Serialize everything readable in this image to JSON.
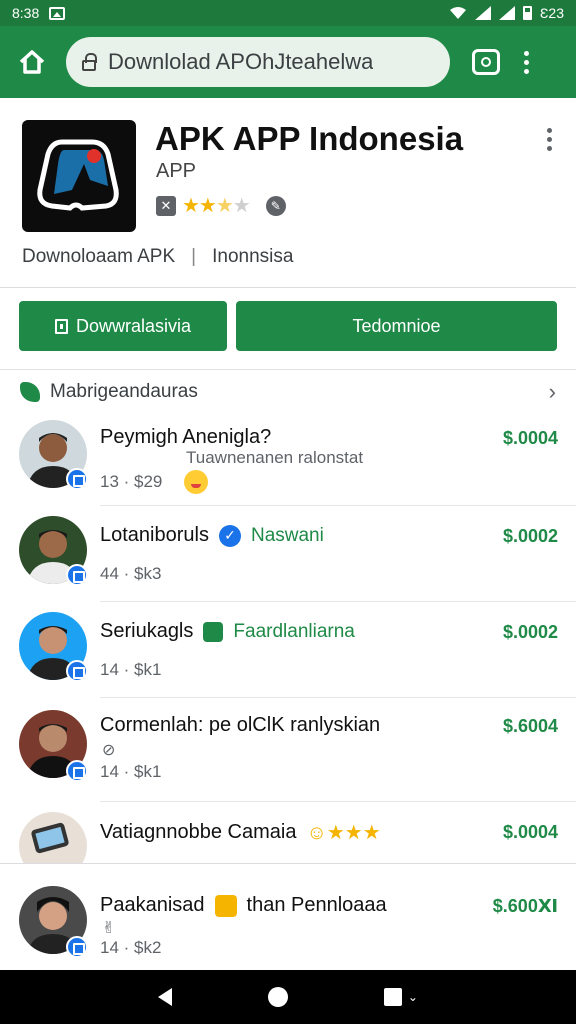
{
  "status_bar": {
    "time": "8:38",
    "right_text": "Ɛ23"
  },
  "toolbar": {
    "url": "Downlolad APOhJteahelwa"
  },
  "app": {
    "name": "APK APP Indonesia",
    "type": "APP",
    "rating": 2.5,
    "developer": "Downoloaam APK",
    "region": "Inonnsisa"
  },
  "buttons": {
    "primary": "Dowwralasivia",
    "secondary": "Tedomnioe"
  },
  "section": {
    "title": "Mabrigeandauras"
  },
  "items": [
    {
      "title": "Peymigh Anenigla?",
      "subtitle": "Tuawnenanen ralonstat",
      "meta": "13 · $29",
      "price": "$.0004"
    },
    {
      "title": "Lotaniboruls",
      "tag": "Naswani",
      "meta": "44 · $k3",
      "price": "$.0002"
    },
    {
      "title": "Seriukagls",
      "tag": "Faardlanliarna",
      "meta": "14 · $k1",
      "price": "$.0002"
    },
    {
      "title": "Cormenlah: pe olClK ranlyskian",
      "meta": "14 · $k1",
      "price": "$.6004"
    },
    {
      "title": "Vatiagnnobbe Camaia",
      "price": "$.0004"
    },
    {
      "title": "Paakanisad",
      "tag": "than Pennloaaa",
      "meta": "14 · $k2",
      "price": "$.600Ⅺ"
    }
  ]
}
